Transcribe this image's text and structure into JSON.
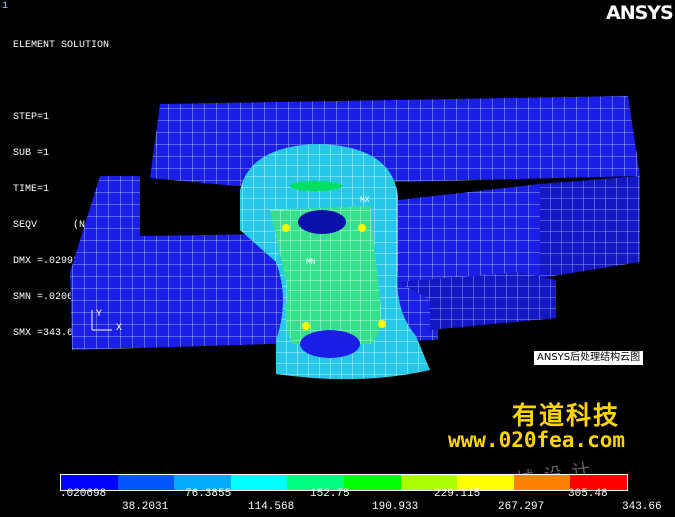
{
  "window_number": "1",
  "logo": "ANSYS",
  "info": {
    "title": "ELEMENT SOLUTION",
    "step": "STEP=1",
    "sub": "SUB =1",
    "time": "TIME=1",
    "seqv": "SEQV      (NOAVG)",
    "dmx": "DMX =.02993",
    "smn": "SMN =.020698",
    "smx": "SMX =343.662"
  },
  "triad": {
    "y_label": "Y",
    "x_label": "X"
  },
  "node_labels": {
    "mx": "MX",
    "mn": "MN"
  },
  "caption": "ANSYS后处理结构云图",
  "brand": {
    "name": "有道科技",
    "url": "www.020fea.com"
  },
  "watermark": "机械设计",
  "colorbar": {
    "colors": [
      "#0000ff",
      "#0055ff",
      "#00aaff",
      "#00ffff",
      "#00ff80",
      "#00ff00",
      "#aaff00",
      "#ffff00",
      "#ff8000",
      "#ff0000"
    ],
    "labels_top": [
      ".020698",
      "76.3855",
      "152.75",
      "229.115",
      "305.48"
    ],
    "labels_bottom": [
      "38.2031",
      "114.568",
      "190.933",
      "267.297",
      "343.66"
    ]
  }
}
